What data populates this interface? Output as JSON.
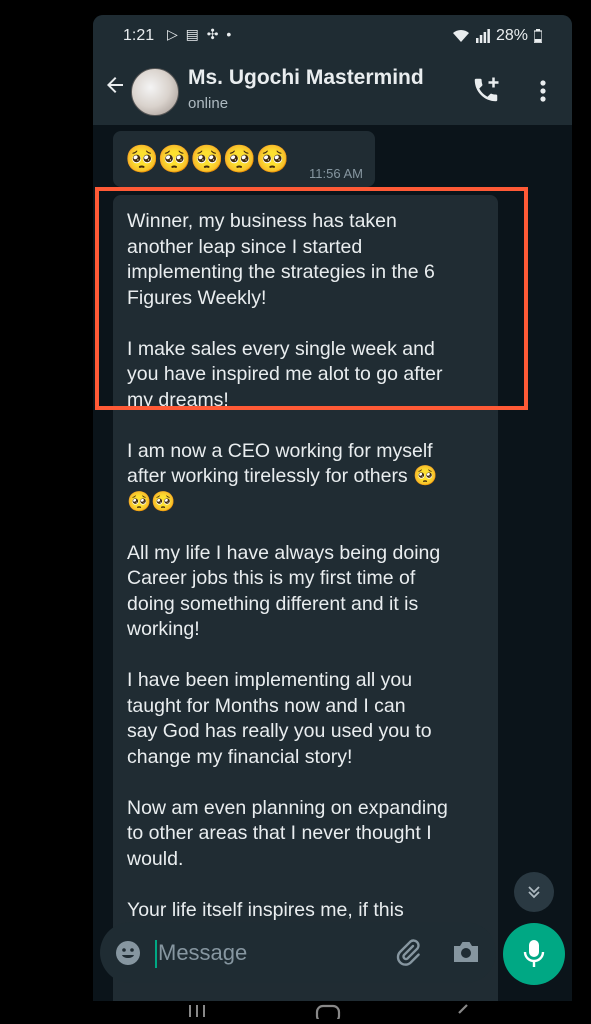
{
  "status_bar": {
    "time": "1:21",
    "left_icons": "▷ ▤ ✣ •",
    "battery": "28%"
  },
  "header": {
    "back_icon": "arrow-left",
    "contact_name": "Ms. Ugochi Mastermind",
    "contact_status": "online",
    "call_icon": "call-add-icon",
    "menu_icon": "more-vert-icon"
  },
  "messages": [
    {
      "text": "🥺🥺🥺🥺🥺",
      "time": "11:56 AM"
    },
    {
      "text": "Winner, my business has taken\nanother leap since I started\nimplementing the strategies in the 6\nFigures Weekly!\n\nI make sales every single week and\nyou have inspired me alot to go after\nmy dreams!\n\nI am now a CEO working for myself\nafter working tirelessly for others 🥺\n🥺🥺\n\nAll my life I have always being doing\nCareer jobs this is my first time of\ndoing something different and it is\nworking!\n\nI have been implementing all you\ntaught for Months now and I can\nsay God has really you used you to\nchange my financial story!\n\nNow am even planning on expanding\nto other areas that I never thought I\nwould.\n\nYour life itself inspires me, if this"
    }
  ],
  "composer": {
    "placeholder": "Message"
  },
  "colors": {
    "highlight": "#ff5a36",
    "accent": "#00a884",
    "bubble": "#202c33"
  }
}
